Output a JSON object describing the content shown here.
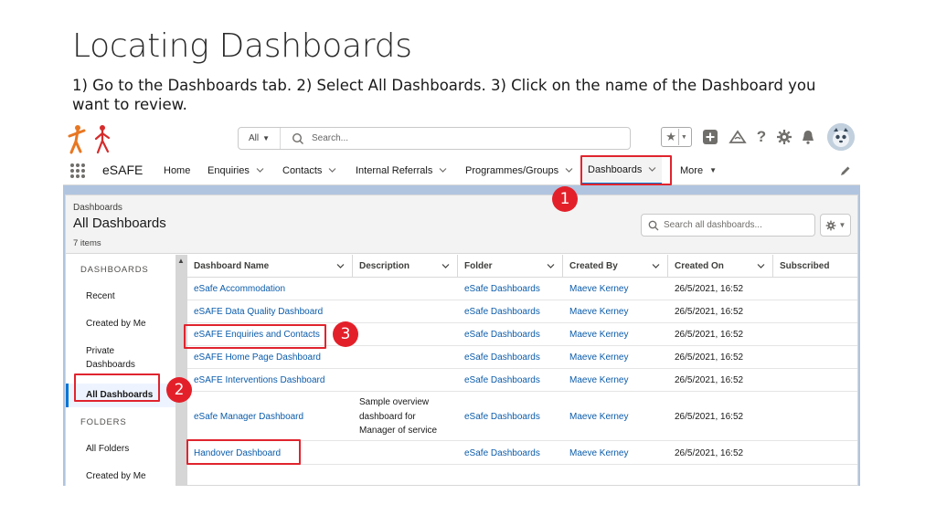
{
  "slide": {
    "title": "Locating Dashboards",
    "subtitle": "1) Go to the Dashboards tab. 2) Select All Dashboards. 3) Click on the name of the Dashboard you want to review."
  },
  "header": {
    "search_scope": "All",
    "search_placeholder": "Search...",
    "utility_icons": [
      "favorites-star-icon",
      "add-icon",
      "trailhead-icon",
      "help-icon",
      "setup-gear-icon",
      "notifications-bell-icon",
      "user-avatar"
    ]
  },
  "nav": {
    "app_name": "eSAFE",
    "items": [
      {
        "label": "Home",
        "has_menu": false
      },
      {
        "label": "Enquiries",
        "has_menu": true
      },
      {
        "label": "Contacts",
        "has_menu": true
      },
      {
        "label": "Internal Referrals",
        "has_menu": true
      },
      {
        "label": "Programmes/Groups",
        "has_menu": true
      },
      {
        "label": "Dashboards",
        "has_menu": true,
        "active": true
      },
      {
        "label": "More",
        "has_menu": true
      }
    ]
  },
  "page_header": {
    "breadcrumb": "Dashboards",
    "title": "All Dashboards",
    "count": "7 items",
    "search_placeholder": "Search all dashboards..."
  },
  "sidebar": {
    "dashboards_heading": "DASHBOARDS",
    "dashboards_items": [
      "Recent",
      "Created by Me",
      "Private Dashboards",
      "All Dashboards"
    ],
    "selected": "All Dashboards",
    "folders_heading": "FOLDERS",
    "folders_items": [
      "All Folders",
      "Created by Me"
    ]
  },
  "table": {
    "columns": [
      "Dashboard Name",
      "Description",
      "Folder",
      "Created By",
      "Created On",
      "Subscribed"
    ],
    "rows": [
      {
        "name": "eSafe Accommodation",
        "description": "",
        "folder": "eSafe Dashboards",
        "created_by": "Maeve Kerney",
        "created_on": "26/5/2021, 16:52"
      },
      {
        "name": "eSAFE Data Quality Dashboard",
        "description": "",
        "folder": "eSafe Dashboards",
        "created_by": "Maeve Kerney",
        "created_on": "26/5/2021, 16:52"
      },
      {
        "name": "eSAFE Enquiries and Contacts",
        "description": "",
        "folder": "eSafe Dashboards",
        "created_by": "Maeve Kerney",
        "created_on": "26/5/2021, 16:52"
      },
      {
        "name": "eSAFE Home Page Dashboard",
        "description": "",
        "folder": "eSafe Dashboards",
        "created_by": "Maeve Kerney",
        "created_on": "26/5/2021, 16:52"
      },
      {
        "name": "eSAFE Interventions Dashboard",
        "description": "",
        "folder": "eSafe Dashboards",
        "created_by": "Maeve Kerney",
        "created_on": "26/5/2021, 16:52"
      },
      {
        "name": "eSafe Manager Dashboard",
        "description": "Sample overview dashboard for Manager of service",
        "folder": "eSafe Dashboards",
        "created_by": "Maeve Kerney",
        "created_on": "26/5/2021, 16:52"
      },
      {
        "name": "Handover Dashboard",
        "description": "",
        "folder": "eSafe Dashboards",
        "created_by": "Maeve Kerney",
        "created_on": "26/5/2021, 16:52"
      }
    ]
  },
  "callouts": [
    "1",
    "2",
    "3"
  ],
  "colors": {
    "callout_red": "#e3202a",
    "link_blue": "#0b5cab",
    "active_tab_blue": "#0176d3",
    "page_bg": "#b0c4df"
  }
}
